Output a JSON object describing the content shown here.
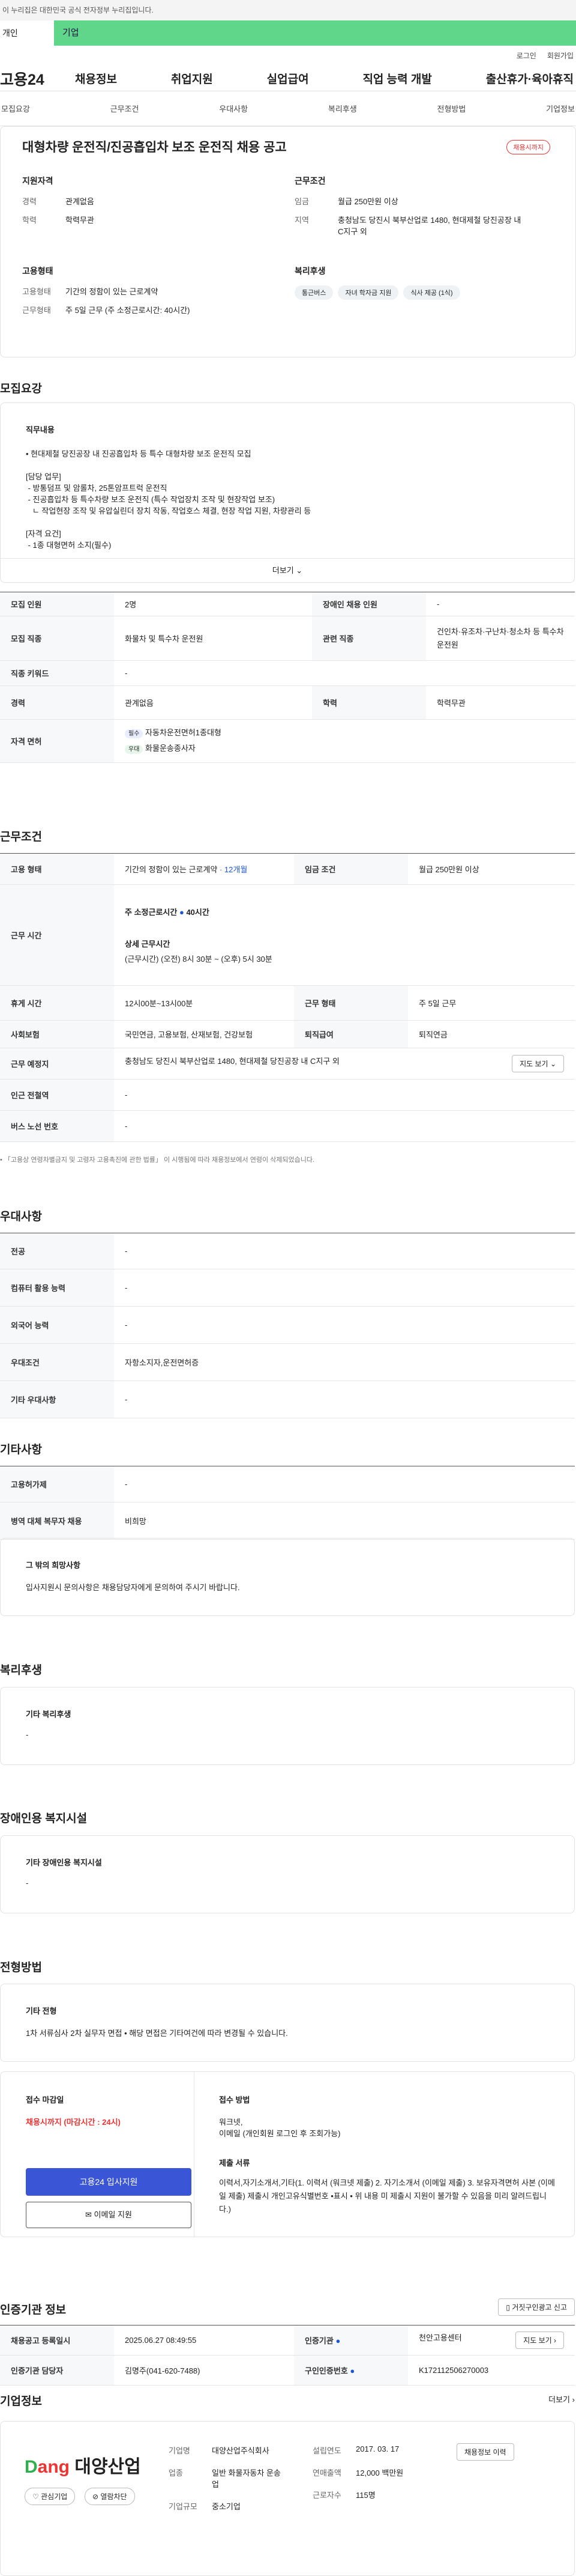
{
  "top_notice": "이 누리집은 대한민국 공식 전자정부 누리집입니다.",
  "tabs": [
    "개인",
    "기업"
  ],
  "utility": [
    "로그인",
    "회원가입"
  ],
  "logo": "고용24",
  "gnb": [
    "채용정보",
    "취업지원",
    "실업급여",
    "직업 능력 개발",
    "출산휴가·육아휴직"
  ],
  "snb": [
    "모집요강",
    "근무조건",
    "우대사항",
    "복리후생",
    "전형방법",
    "기업정보"
  ],
  "job": {
    "title": "대형차량 운전직/진공흡입차 보조 운전직 채용 공고",
    "status_badge": "채용시까지",
    "qual_title": "지원자격",
    "qual": [
      {
        "k": "경력",
        "v": "관계없음"
      },
      {
        "k": "학력",
        "v": "학력무관"
      }
    ],
    "cond_title": "근무조건",
    "cond": [
      {
        "k": "임금",
        "v": "월급 250만원 이상"
      },
      {
        "k": "지역",
        "v": "충청남도 당진시 북부산업로 1480, 현대제철 당진공장 내 C지구 외"
      }
    ],
    "type_title": "고용형태",
    "type": [
      {
        "k": "고용형태",
        "v": "기간의 정함이 있는 근로계약"
      },
      {
        "k": "근무형태",
        "v": "주 5일 근무 (주 소정근로시간: 40시간)"
      }
    ],
    "welfare_title": "복리후생",
    "welfare_chips": [
      "통근버스",
      "자녀 학자금 지원",
      "식사 제공 (1식)"
    ]
  },
  "recruit": {
    "section_title": "모집요강",
    "duty_title": "직무내용",
    "duty_lines": [
      "• 현대제철 당진공장 내 진공흡입차 등 특수 대형차량 보조 운전직 모집",
      "",
      "[담당 업무]",
      " - 방통덤프 및 암롤차, 25톤암프트럭 운전직",
      " - 진공흡입차 등 특수차량 보조 운전직 (특수 작업장치 조작 및 현장작업 보조)",
      "   ㄴ 작업현장 조작 및 유압실린더 장치 작동, 작업호스 체결, 현장 작업 지원, 차량관리 등",
      "",
      "[자격 요건]",
      " - 1종 대형면허 소지(필수)"
    ],
    "more": "더보기",
    "rows": [
      {
        "k1": "모집 인원",
        "v1": "2명",
        "k2": "장애인 채용 인원",
        "v2": "-"
      },
      {
        "k1": "모집 직종",
        "v1": "화물차 및 특수차 운전원",
        "k2": "관련 직종",
        "v2": "건인차·유조차·구난차·청소차 등 특수차 운전원"
      },
      {
        "k1": "직종 키워드",
        "v1": "-"
      },
      {
        "k1": "경력",
        "v1": "관계없음",
        "k2": "학력",
        "v2": "학력무관"
      }
    ],
    "license_label": "자격 면허",
    "licenses": [
      {
        "tag": "필수",
        "name": "자동차운전면허1종대형"
      },
      {
        "tag": "우대",
        "name": "화물운송종사자"
      }
    ]
  },
  "work": {
    "section_title": "근무조건",
    "emp_type_k": "고용 형태",
    "emp_type_v": "기간의 정함이 있는 근로계약",
    "emp_period": "· 12개월",
    "wage_k": "임금 조건",
    "wage_v": "월급 250만원 이상",
    "hours_k": "근무 시간",
    "hours_summary": "주 소정근로시간",
    "hours_num": "40시간",
    "hours_detail_title": "상세 근무시간",
    "hours_detail": "(근무시간) (오전) 8시 30분 ~ (오후) 5시 30분",
    "break_k": "휴게 시간",
    "break_v": "12시00분~13시00분",
    "shift_k": "근무 형태",
    "shift_v": "주 5일 근무",
    "ins_k": "사회보험",
    "ins_v": "국민연금, 고용보험, 산재보험, 건강보험",
    "ret_k": "퇴직급여",
    "ret_v": "퇴직연금",
    "place_k": "근무 예정지",
    "place_v": "충청남도 당진시 북부산업로 1480, 현대제철 당진공장 내 C지구 외",
    "map_btn": "지도 보기",
    "subway_k": "인근 전철역",
    "subway_v": "-",
    "bus_k": "버스 노선 번호",
    "bus_v": "-",
    "footnote": "• 「고용상 연령차별금지 및 고령자 고용촉진에 관한 법률」 이 시행됨에 따라 채용정보에서 연령이 삭제되었습니다."
  },
  "prefer": {
    "section_title": "우대사항",
    "rows": [
      {
        "k": "전공",
        "v": "-"
      },
      {
        "k": "컴퓨터 활용 능력",
        "v": "-"
      },
      {
        "k": "외국어 능력",
        "v": "-"
      },
      {
        "k": "우대조건",
        "v": "자항소지자,운전면허증"
      },
      {
        "k": "기타 우대사항",
        "v": "-"
      }
    ]
  },
  "etc": {
    "section_title": "기타사항",
    "rows": [
      {
        "k": "고용허가제",
        "v": "-"
      },
      {
        "k": "병역 대체 복무자 채용",
        "v": "비희망"
      }
    ],
    "box_title": "그 밖의 희망사항",
    "box_text": "입사지원시 문의사항은 채용담당자에게 문의하여 주시기 바랍니다."
  },
  "welfare": {
    "section_title": "복리후생",
    "box_title": "기타 복리후생",
    "box_text": "-"
  },
  "disabled": {
    "section_title": "장애인용 복지시설",
    "box_title": "기타 장애인용 복지시설",
    "box_text": "-"
  },
  "select": {
    "section_title": "전형방법",
    "box_title": "기타 전형",
    "box_text": "1차 서류심사 2차 실무자 면접 • 해당 면접은 기타여건에 따라 변경될 수 있습니다.",
    "deadline_title": "접수 마감일",
    "deadline_text": "채용시까지 (마감시간 : 24시)",
    "apply_btn": "고용24 입사지원",
    "email_btn": "이메일 지원",
    "method_title": "접수 방법",
    "method_lines": [
      "워크넷,",
      "이메일 (개인회원 로그인 후 조회가능)"
    ],
    "docs_title": "제출 서류",
    "docs_text": "이력서,자기소개서,기타(1. 이력서 (워크넷 제출) 2. 자기소개서 (이메일 제출) 3. 보유자격면허 사본 (이메일 제출) 제출시 개인고유식별번호 •표시 • 위 내용 미 제출시 지원이 불가할 수 있음을 미리 알려드립니다.)"
  },
  "cert": {
    "section_title": "인증기관 정보",
    "report_btn": "거짓구인광고 신고",
    "rows": [
      {
        "k1": "채용공고 등록일시",
        "v1": "2025.06.27 08:49:55",
        "k2": "인증기관",
        "v2": "천안고용센터",
        "btn": "지도 보기"
      },
      {
        "k1": "인증기관 담당자",
        "v1": "김명주(041-620-7488)",
        "k2": "구인인증번호",
        "v2": "K172112506270003"
      }
    ]
  },
  "company": {
    "section_title": "기업정보",
    "more": "더보기",
    "logo_text": "대양산업",
    "fav_btn": "관심기업",
    "block_btn": "열람차단",
    "rows": [
      {
        "k": "기업명",
        "v": "대양산업주식회사"
      },
      {
        "k": "업종",
        "v": "일반 화물자동차 운송업"
      },
      {
        "k": "기업규모",
        "v": "중소기업"
      }
    ],
    "rows2": [
      {
        "k": "설립연도",
        "v": "2017. 03. 17"
      },
      {
        "k": "연매출액",
        "v": "12,000 백만원"
      },
      {
        "k": "근로자수",
        "v": "115명"
      }
    ],
    "history_btn": "채용정보 이력"
  },
  "colors": {
    "accent_green": "#5fd68a",
    "primary_blue": "#3a56d6",
    "red": "#e33333"
  }
}
